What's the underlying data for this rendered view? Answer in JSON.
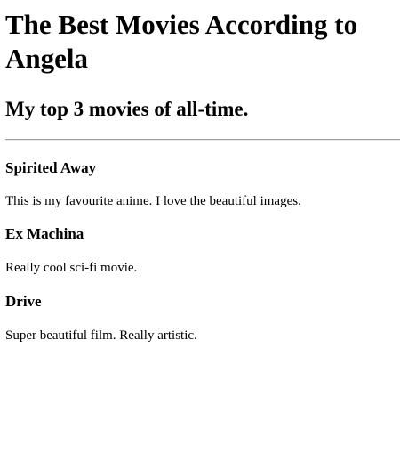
{
  "page": {
    "title": "The Best Movies According to Angela",
    "subtitle": "My top 3 movies of all-time."
  },
  "movies": [
    {
      "title": "Spirited Away",
      "description": "This is my favourite anime. I love the beautiful images."
    },
    {
      "title": "Ex Machina",
      "description": "Really cool sci-fi movie."
    },
    {
      "title": "Drive",
      "description": "Super beautiful film. Really artistic."
    }
  ]
}
